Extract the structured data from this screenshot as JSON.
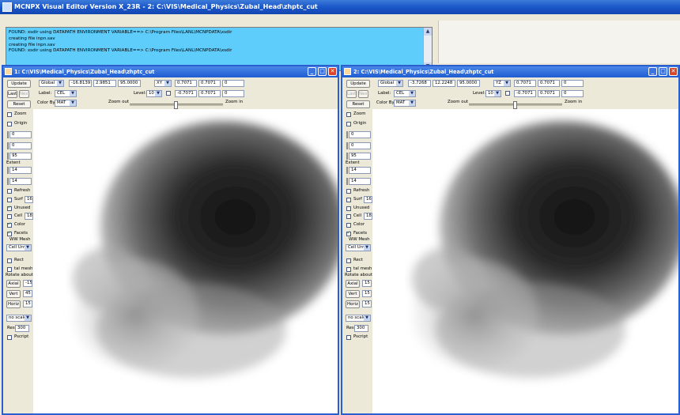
{
  "app": {
    "title": "MCNPX Visual Editor Version X_23R  -  2:  C:\\VIS\\Medical_Physics\\Zubal_Head\\zhptc_cut"
  },
  "messages": [
    "FOUND: xsdir  using DATAPATH ENVIRONMENT VARIABLE==>  C:\\Program Files\\LANL\\MCNPDATA\\xsdir",
    "creating file inpn.sav",
    "creating file inpn.sav",
    "FOUND: xsdir  using DATAPATH ENVIRONMENT VARIABLE==>  C:\\Program Files\\LANL\\MCNPDATA\\xsdir"
  ],
  "win1": {
    "title": "1:  C:\\VIS\\Medical_Physics\\Zubal_Head\\zhptc_cut",
    "update": "Update",
    "last": "Last",
    "next": "Next",
    "reset": "Reset",
    "coord_system": "Global",
    "origin": [
      "-16.8139",
      "2.9851",
      "95.0000"
    ],
    "plane": "XY",
    "basis1": [
      "0.7071",
      "0.7071",
      "0"
    ],
    "basis2": [
      "-0.7071",
      "0.7071",
      "0"
    ],
    "label_text": "Label:",
    "label_val": "CEL",
    "level_text": "Level:",
    "level_val": "10",
    "colorby_text": "Color By:",
    "colorby_val": "MAT",
    "zoom_out": "Zoom out",
    "zoom_in": "Zoom in",
    "side": {
      "zoom": "Zoom",
      "origin": "Origin",
      "v1": "0",
      "v2": "0",
      "v3": "95",
      "extent": "Extent",
      "e1": "14",
      "e2": "14",
      "refresh": "Refresh",
      "surf": "Surf",
      "surf_n": "16",
      "unused": "Unused",
      "cell": "Cell",
      "cell_n": "18",
      "color": "Color",
      "facets": "Facets",
      "wwmesh": "WW Mesh",
      "celluniv": "Cell Unv",
      "rect": "Rect",
      "tal": "tal mesh",
      "rotate": "Rotate about",
      "axial": "Axial",
      "axial_n": "-15",
      "vert": "Vert",
      "vert_n": "45",
      "horiz": "Horiz",
      "horiz_n": "15",
      "scale": "no scale",
      "res": "Res",
      "res_n": "300",
      "pscript": "Pscript"
    }
  },
  "win2": {
    "title": "2:  C:\\VIS\\Medical_Physics\\Zubal_Head\\zhptc_cut",
    "update": "Update",
    "last": "Last",
    "next": "Next",
    "reset": "Reset",
    "coord_system": "Global",
    "origin": [
      "-3.7268",
      "12.2248",
      "95.0000"
    ],
    "plane": "YZ",
    "basis1": [
      "0.7071",
      "0.7071",
      "0"
    ],
    "basis2": [
      "-0.7071",
      "0.7071",
      "0"
    ],
    "label_text": "Label:",
    "label_val": "CEL",
    "level_text": "Level:",
    "level_val": "10",
    "colorby_text": "Color By:",
    "colorby_val": "MAT",
    "zoom_out": "Zoom out",
    "zoom_in": "Zoom in",
    "side": {
      "zoom": "Zoom",
      "origin": "Origin",
      "v1": "0",
      "v2": "0",
      "v3": "95",
      "extent": "Extent",
      "e1": "14",
      "e2": "14",
      "refresh": "Refresh",
      "surf": "Surf",
      "surf_n": "16",
      "unused": "Unused",
      "cell": "Cell",
      "cell_n": "18",
      "color": "Color",
      "facets": "Facets",
      "wwmesh": "WW Mesh",
      "celluniv": "Cell Unv",
      "rect": "Rect",
      "tal": "tal mesh",
      "rotate": "Rotate about",
      "axial": "Axial",
      "axial_n": "15",
      "vert": "Vert",
      "vert_n": "15",
      "horiz": "Horiz",
      "horiz_n": "15",
      "scale": "no scale",
      "res": "Res",
      "res_n": "300",
      "pscript": "Pscript"
    }
  },
  "colors": {
    "title_blue": "#1a57c9",
    "msg_bg": "#5ecdfc",
    "close_red": "#d9472b"
  }
}
